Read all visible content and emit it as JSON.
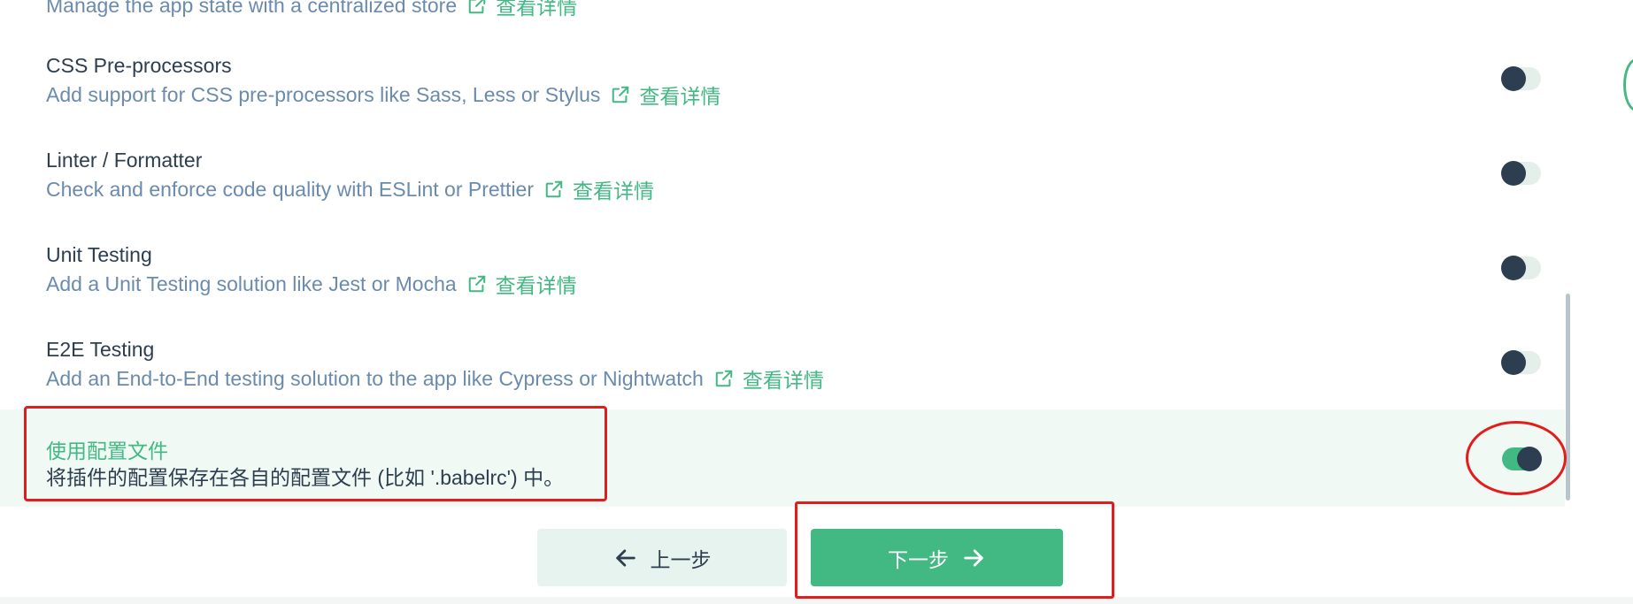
{
  "features": [
    {
      "title": "",
      "description": "Manage the app state with a centralized store",
      "more": "查看详情",
      "enabled": false
    },
    {
      "title": "CSS Pre-processors",
      "description": "Add support for CSS pre-processors like Sass, Less or Stylus",
      "more": "查看详情",
      "enabled": false
    },
    {
      "title": "Linter / Formatter",
      "description": "Check and enforce code quality with ESLint or Prettier",
      "more": "查看详情",
      "enabled": false
    },
    {
      "title": "Unit Testing",
      "description": "Add a Unit Testing solution like Jest or Mocha",
      "more": "查看详情",
      "enabled": false
    },
    {
      "title": "E2E Testing",
      "description": "Add an End-to-End testing solution to the app like Cypress or Nightwatch",
      "more": "查看详情",
      "enabled": false
    },
    {
      "title": "使用配置文件",
      "description": "将插件的配置保存在各自的配置文件 (比如 '.babelrc') 中。",
      "enabled": true
    }
  ],
  "buttons": {
    "prev_label": "上一步",
    "next_label": "下一步"
  },
  "icons": {
    "external": "external-link-icon",
    "prev": "arrow-left-icon",
    "next": "arrow-right-icon"
  },
  "colors": {
    "accent": "#42b983",
    "text": "#2c3e50",
    "muted": "#6a8bad",
    "highlight_bg": "#f0f9f4",
    "annotation": "#e11d1d"
  }
}
